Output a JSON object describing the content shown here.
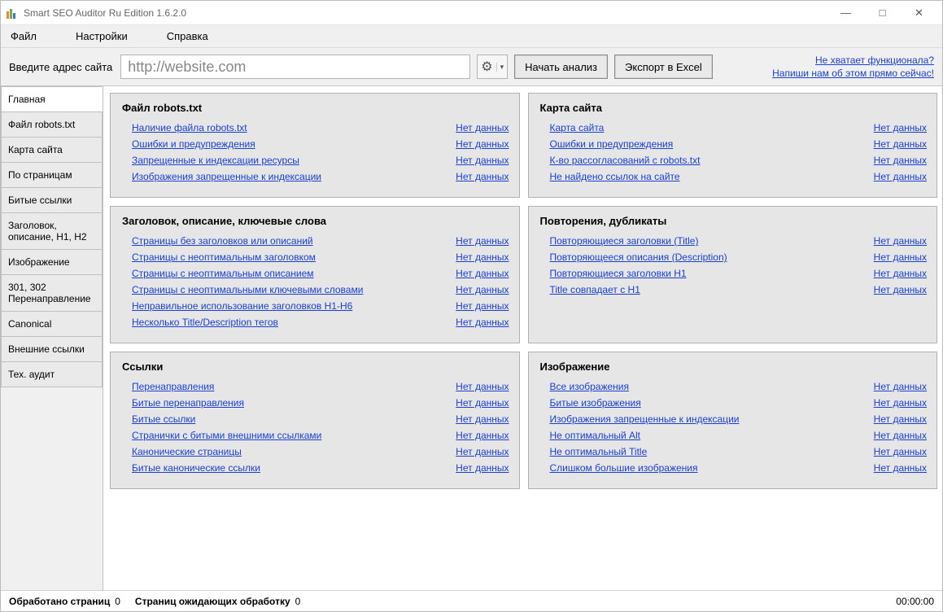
{
  "window": {
    "title": "Smart SEO Auditor Ru Edition 1.6.2.0",
    "minimize": "—",
    "maximize": "□",
    "close": "✕"
  },
  "menu": {
    "file": "Файл",
    "settings": "Настройки",
    "help": "Справка"
  },
  "toolbar": {
    "label": "Введите адрес сайта",
    "url": "http://website.com",
    "start": "Начать анализ",
    "export": "Экспорт в Excel"
  },
  "promo": {
    "line1": "Не хватает функционала?",
    "line2": "Напиши нам об этом прямо сейчас!"
  },
  "sidebar": {
    "tabs": [
      "Главная",
      "Файл robots.txt",
      "Карта сайта",
      "По страницам",
      "Битые ссылки",
      "Заголовок, описание, H1, H2",
      "Изображение",
      "301, 302 Перенаправление",
      "Canonical",
      "Внешние ссылки",
      "Тех. аудит"
    ],
    "active": 0
  },
  "no_data": "Нет данных",
  "cards": [
    {
      "title": "Файл robots.txt",
      "items": [
        "Наличие файла robots.txt",
        "Ошибки и предупреждения",
        "Запрещенные к индексации ресурсы",
        "Изображения запрещенные к индексации"
      ]
    },
    {
      "title": "Карта сайта",
      "items": [
        "Карта сайта",
        "Ошибки и предупреждения",
        "К-во рассогласований с robots.txt",
        "Не найдено ссылок на сайте"
      ]
    },
    {
      "title": "Заголовок, описание, ключевые слова",
      "items": [
        "Страницы без заголовков или описаний",
        "Страницы с неоптимальным заголовком",
        "Страницы с неоптимальным описанием",
        "Страницы с неоптимальными ключевыми словами",
        "Неправильное использование заголовков H1-H6",
        "Несколько Title/Description тегов"
      ]
    },
    {
      "title": "Повторения, дубликаты",
      "items": [
        "Повторяющиеся заголовки (Title)",
        "Повторяющееся описания (Description)",
        "Повторяющиеся заголовки H1",
        "Title совпадает с H1"
      ]
    },
    {
      "title": "Ссылки",
      "items": [
        "Перенаправления",
        "Битые перенаправления",
        "Битые ссылки",
        "Странички с битыми внешними ссылками",
        "Канонические страницы",
        "Битые канонические ссылки"
      ]
    },
    {
      "title": "Изображение",
      "items": [
        "Все изображения",
        "Битые изображения",
        "Изображения запрещенные к индексации",
        "Не оптимальный Alt",
        "Не оптимальный Title",
        "Слишком большие изображения"
      ]
    }
  ],
  "status": {
    "processed_label": "Обработано страниц",
    "processed_value": "0",
    "pending_label": "Страниц ожидающих обработку",
    "pending_value": "0",
    "time": "00:00:00"
  }
}
